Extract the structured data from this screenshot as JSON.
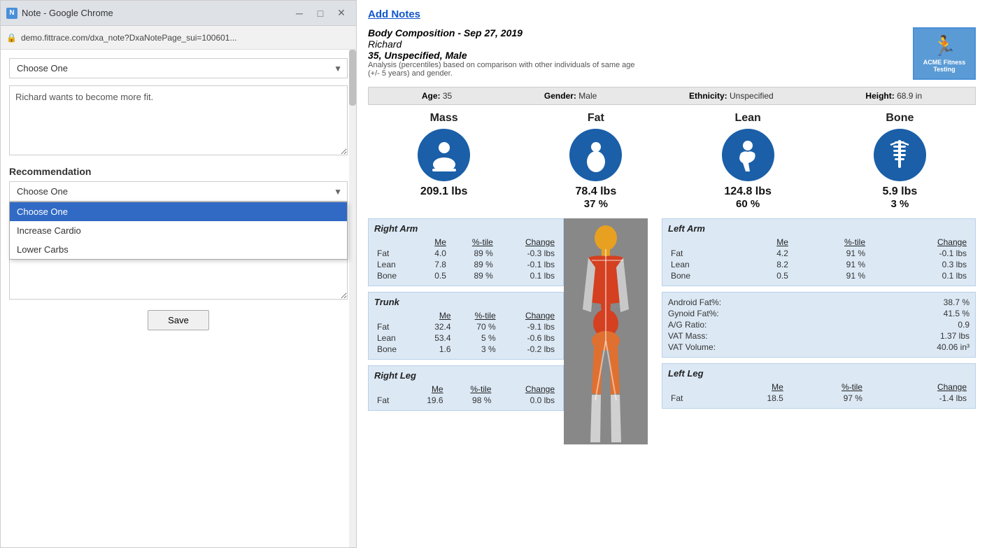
{
  "window": {
    "title": "Note - Google Chrome",
    "address": "demo.fittrace.com/dxa_note?DxaNotePage_sui=100601...",
    "controls": {
      "minimize": "─",
      "maximize": "□",
      "close": "✕"
    }
  },
  "left_panel": {
    "dropdown1": {
      "value": "Choose One",
      "options": [
        "Choose One",
        "Increase Cardio",
        "Lower Carbs"
      ]
    },
    "textarea1": {
      "value": "Richard wants to become more fit.",
      "placeholder": ""
    },
    "recommendation_label": "Recommendation",
    "dropdown2": {
      "value": "Choose One",
      "options": [
        "Choose One",
        "Increase Cardio",
        "Lower Carbs"
      ],
      "is_open": true,
      "selected_index": 0
    },
    "textarea2": {
      "value": "",
      "placeholder": ""
    },
    "save_button": "Save"
  },
  "report": {
    "add_notes_link": "Add Notes",
    "title": "Body Composition - Sep 27, 2019",
    "name": "Richard",
    "age_gender": "35, Unspecified, Male",
    "analysis_note": "Analysis (percentiles) based on comparison with other individuals of same age (+/- 5 years) and gender.",
    "logo": {
      "icon": "🏃",
      "line1": "ACME Fitness",
      "line2": "Testing"
    },
    "info_bar": {
      "age_label": "Age:",
      "age_value": "35",
      "gender_label": "Gender:",
      "gender_value": "Male",
      "ethnicity_label": "Ethnicity:",
      "ethnicity_value": "Unspecified",
      "height_label": "Height:",
      "height_value": "68.9 in"
    },
    "metrics": [
      {
        "title": "Mass",
        "icon": "mass",
        "value": "209.1 lbs",
        "pct": ""
      },
      {
        "title": "Fat",
        "icon": "fat",
        "value": "78.4 lbs",
        "pct": "37 %"
      },
      {
        "title": "Lean",
        "icon": "lean",
        "value": "124.8 lbs",
        "pct": "60 %"
      },
      {
        "title": "Bone",
        "icon": "bone",
        "value": "5.9 lbs",
        "pct": "3 %"
      }
    ],
    "right_arm": {
      "title": "Right Arm",
      "columns": [
        "",
        "Me",
        "%-tile",
        "Change"
      ],
      "rows": [
        [
          "Fat",
          "4.0",
          "89 %",
          "-0.3 lbs"
        ],
        [
          "Lean",
          "7.8",
          "89 %",
          "-0.1 lbs"
        ],
        [
          "Bone",
          "0.5",
          "89 %",
          "0.1 lbs"
        ]
      ]
    },
    "trunk": {
      "title": "Trunk",
      "columns": [
        "",
        "Me",
        "%-tile",
        "Change"
      ],
      "rows": [
        [
          "Fat",
          "32.4",
          "70 %",
          "-9.1 lbs"
        ],
        [
          "Lean",
          "53.4",
          "5 %",
          "-0.6 lbs"
        ],
        [
          "Bone",
          "1.6",
          "3 %",
          "-0.2 lbs"
        ]
      ]
    },
    "right_leg": {
      "title": "Right Leg",
      "columns": [
        "",
        "Me",
        "%-tile",
        "Change"
      ],
      "rows": [
        [
          "Fat",
          "19.6",
          "98 %",
          "0.0 lbs"
        ]
      ]
    },
    "left_arm": {
      "title": "Left Arm",
      "columns": [
        "",
        "Me",
        "%-tile",
        "Change"
      ],
      "rows": [
        [
          "Fat",
          "4.2",
          "91 %",
          "-0.1 lbs"
        ],
        [
          "Lean",
          "8.2",
          "91 %",
          "0.3 lbs"
        ],
        [
          "Bone",
          "0.5",
          "91 %",
          "0.1 lbs"
        ]
      ]
    },
    "android_stats": {
      "rows": [
        [
          "Android Fat%:",
          "38.7 %"
        ],
        [
          "Gynoid Fat%:",
          "41.5 %"
        ],
        [
          "A/G Ratio:",
          "0.9"
        ],
        [
          "VAT Mass:",
          "1.37 lbs"
        ],
        [
          "VAT Volume:",
          "40.06 in³"
        ]
      ]
    },
    "left_leg": {
      "title": "Left Leg",
      "columns": [
        "",
        "Me",
        "%-tile",
        "Change"
      ],
      "rows": [
        [
          "Fat",
          "18.5",
          "97 %",
          "-1.4 lbs"
        ]
      ]
    },
    "trunk_label": "Trunk",
    "fat_label": "Fat",
    "lean_label": "Lean",
    "bone_label": "Bone"
  }
}
